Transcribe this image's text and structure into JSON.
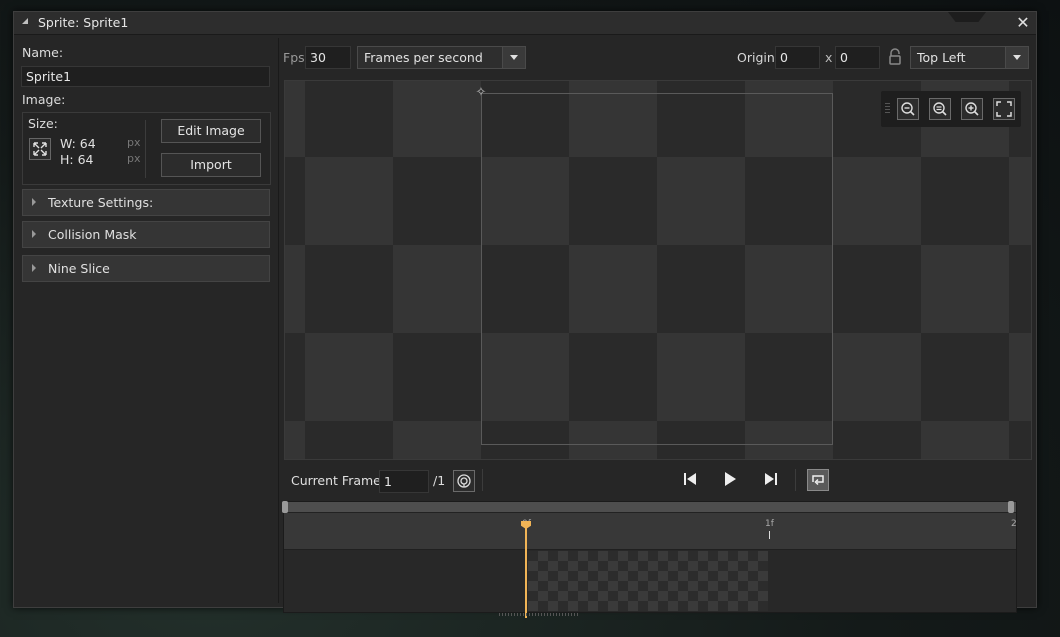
{
  "window": {
    "title": "Sprite: Sprite1",
    "close_symbol": "✕"
  },
  "left": {
    "name_label": "Name:",
    "name_value": "Sprite1",
    "image_label": "Image:",
    "size_label": "Size:",
    "width_text": "W: 64",
    "height_text": "H: 64",
    "px_unit": "px",
    "edit_image_label": "Edit Image",
    "import_label": "Import",
    "sections": [
      "Texture Settings:",
      "Collision Mask",
      "Nine Slice"
    ]
  },
  "toolbar": {
    "fps_label": "Fps",
    "fps_value": "30",
    "fps_mode": "Frames per second",
    "origin_label": "Origin",
    "origin_x": "0",
    "origin_sep": "x",
    "origin_y": "0",
    "origin_preset": "Top Left"
  },
  "frame_bar": {
    "current_frame_label": "Current Frame:",
    "current_frame_value": "1",
    "total_frames": "/1"
  },
  "timeline": {
    "ticks": [
      "0f",
      "1f",
      "2"
    ]
  },
  "colors": {
    "playhead": "#f1b456",
    "panel": "#262626",
    "canvas_dark": "#2a2a2a",
    "canvas_light": "#353535"
  }
}
